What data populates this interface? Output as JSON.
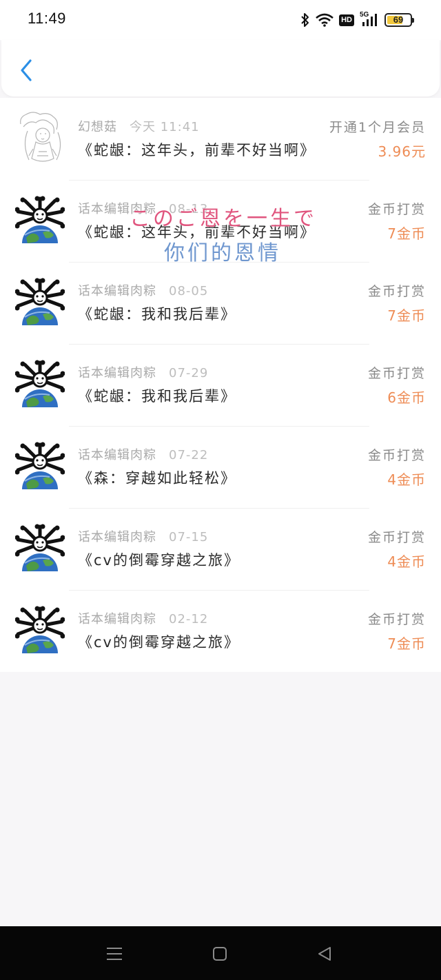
{
  "status_bar": {
    "time": "11:49",
    "hd_label": "HD",
    "network_label": "5G",
    "battery_level": "69",
    "battery_fraction": 0.69
  },
  "header": {
    "back_icon": "chevron-left-icon",
    "accent_color": "#2b8fe6"
  },
  "overlay": {
    "line1": "このご恩を一生で",
    "line2": "你们的恩情"
  },
  "records": [
    {
      "name": "幻想菇",
      "date": "今天 11:41",
      "title": "《蛇龈：这年头，前辈不好当啊》",
      "type": "开通1个月会员",
      "amount": "3.96元",
      "avatar": "sketch-avatar"
    },
    {
      "name": "话本编辑肉粽",
      "date": "08-13",
      "title": "《蛇龈：这年头，前辈不好当啊》",
      "type": "金币打赏",
      "amount": "7金币",
      "avatar": "globe-avatar"
    },
    {
      "name": "话本编辑肉粽",
      "date": "08-05",
      "title": "《蛇龈：我和我后辈》",
      "type": "金币打赏",
      "amount": "7金币",
      "avatar": "globe-avatar"
    },
    {
      "name": "话本编辑肉粽",
      "date": "07-29",
      "title": "《蛇龈：我和我后辈》",
      "type": "金币打赏",
      "amount": "6金币",
      "avatar": "globe-avatar"
    },
    {
      "name": "话本编辑肉粽",
      "date": "07-22",
      "title": "《森：穿越如此轻松》",
      "type": "金币打赏",
      "amount": "4金币",
      "avatar": "globe-avatar"
    },
    {
      "name": "话本编辑肉粽",
      "date": "07-15",
      "title": "《cv的倒霉穿越之旅》",
      "type": "金币打赏",
      "amount": "4金币",
      "avatar": "globe-avatar"
    },
    {
      "name": "话本编辑肉粽",
      "date": "02-12",
      "title": "《cv的倒霉穿越之旅》",
      "type": "金币打赏",
      "amount": "7金币",
      "avatar": "globe-avatar"
    }
  ],
  "nav_bar": {
    "menu_icon": "menu-icon",
    "home_icon": "home-square-icon",
    "back_icon": "back-triangle-icon"
  },
  "colors": {
    "amount": "#ee8c55",
    "overlay_pink": "#e0557e",
    "overlay_blue": "#6f97cf"
  }
}
